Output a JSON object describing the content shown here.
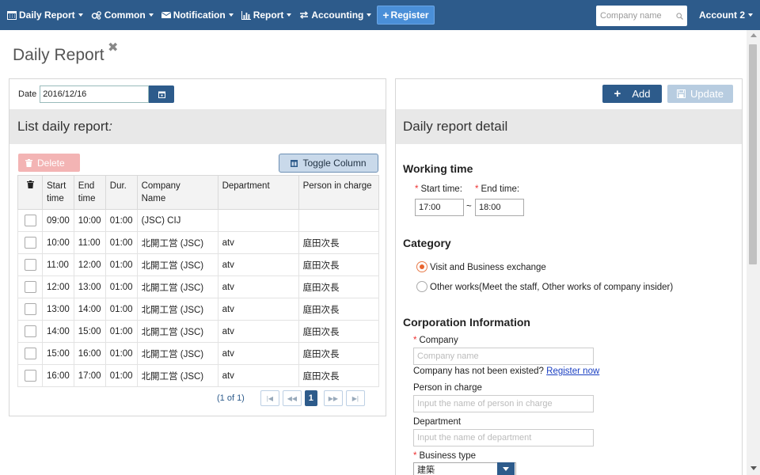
{
  "nav": {
    "items": [
      {
        "label": "Daily Report",
        "icon": "calendar-icon"
      },
      {
        "label": "Common",
        "icon": "cogs-icon"
      },
      {
        "label": "Notification",
        "icon": "envelope-icon"
      },
      {
        "label": "Report",
        "icon": "bar-chart-icon"
      },
      {
        "label": "Accounting",
        "icon": "exchange-icon"
      }
    ],
    "register_label": "Register",
    "search_placeholder": "Company name",
    "account_label": "Account 2"
  },
  "page": {
    "title": "Daily Report"
  },
  "left": {
    "date_label": "Date",
    "date_value": "2016/12/16",
    "list_title": "List daily report",
    "list_title_suffix": " :",
    "delete_label": "Delete",
    "toggle_label": "Toggle Column",
    "table": {
      "headers": [
        "",
        "Start\ntime",
        "End\ntime",
        "Dur.",
        "Company\nName",
        "Department",
        "Person in charge"
      ],
      "rows": [
        [
          "09:00",
          "10:00",
          "01:00",
          "(JSC) CIJ",
          "",
          ""
        ],
        [
          "10:00",
          "11:00",
          "01:00",
          "北開工営 (JSC)",
          "atv",
          "庭田次長"
        ],
        [
          "11:00",
          "12:00",
          "01:00",
          "北開工営 (JSC)",
          "atv",
          "庭田次長"
        ],
        [
          "12:00",
          "13:00",
          "01:00",
          "北開工営 (JSC)",
          "atv",
          "庭田次長"
        ],
        [
          "13:00",
          "14:00",
          "01:00",
          "北開工営 (JSC)",
          "atv",
          "庭田次長"
        ],
        [
          "14:00",
          "15:00",
          "01:00",
          "北開工営 (JSC)",
          "atv",
          "庭田次長"
        ],
        [
          "15:00",
          "16:00",
          "01:00",
          "北開工営 (JSC)",
          "atv",
          "庭田次長"
        ],
        [
          "16:00",
          "17:00",
          "01:00",
          "北開工営 (JSC)",
          "atv",
          "庭田次長"
        ]
      ]
    },
    "pager": {
      "text": "(1 of 1)",
      "current_page": "1"
    }
  },
  "right": {
    "add_label": "Add",
    "update_label": "Update",
    "detail_title": "Daily report detail",
    "working_time_title": "Working time",
    "start_time_label": "Start time:",
    "end_time_label": "End time:",
    "start_time_value": "17:00",
    "end_time_value": "18:00",
    "time_separator": "~",
    "category_title": "Category",
    "category_options": [
      {
        "label": "Visit and Business exchange",
        "selected": true
      },
      {
        "label": "Other works(Meet the staff, Other works of company insider)",
        "selected": false
      }
    ],
    "corp_title": "Corporation Information",
    "company_label": "Company",
    "company_placeholder": "Company name",
    "company_hint": "Company has not been existed?",
    "register_now_label": "Register now",
    "person_label": "Person in charge",
    "person_placeholder": "Input the name of person in charge",
    "department_label": "Department",
    "department_placeholder": "Input the name of department",
    "business_type_label": "Business type",
    "business_type_value": "建築"
  },
  "colors": {
    "navbar": "#2d5b8b",
    "accent": "#2d5b8b",
    "delete_disabled": "#f3b4b4",
    "required": "#e33333",
    "radio_selected": "#e8642e"
  }
}
